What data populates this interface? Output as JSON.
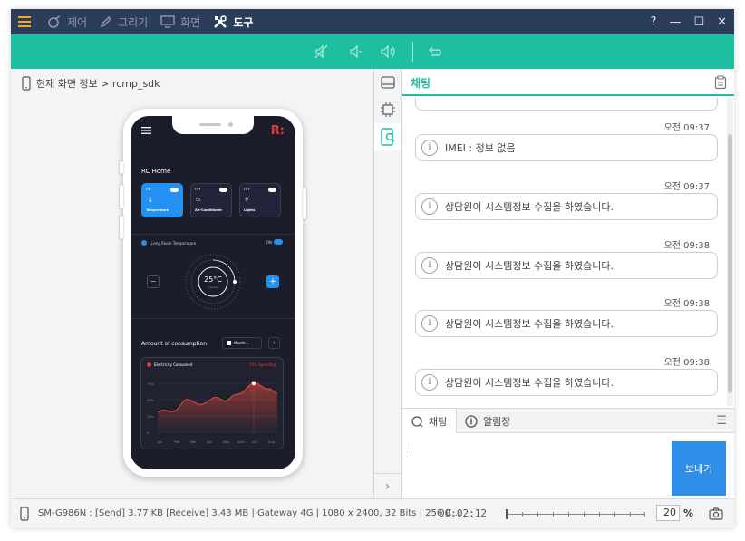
{
  "titlebar": {
    "menus": [
      {
        "label": "제어",
        "icon": "control-icon"
      },
      {
        "label": "그리기",
        "icon": "pen-icon"
      },
      {
        "label": "화면",
        "icon": "monitor-icon"
      },
      {
        "label": "도구",
        "icon": "tools-icon"
      }
    ],
    "active_menu": "도구",
    "help": "?",
    "minimize": "—",
    "maximize": "☐",
    "close": "✕"
  },
  "breadcrumb": {
    "text": "현재 화면 정보 > rcmp_sdk"
  },
  "phone_app": {
    "title": "RC Home",
    "logo": "R:",
    "cards": [
      {
        "state": "ON",
        "label": "Temperature"
      },
      {
        "state": "OFF",
        "label": "Air-Conditioner"
      },
      {
        "state": "OFF",
        "label": "Lights"
      }
    ],
    "room_label": "Living Room Temperature",
    "room_toggle": "ON",
    "temperature": "25°C",
    "temperature_sub": "Celsius",
    "minus": "−",
    "plus": "+",
    "consumption_title": "Amount of consumption",
    "period": "Month",
    "electricity_label": "Electricity Consumed",
    "spending_label": "75% Spending",
    "y_ticks": [
      "75%",
      "50%",
      "25%",
      "0"
    ],
    "months": [
      "Jan",
      "Feb",
      "Mar",
      "Apr",
      "May",
      "June",
      "July",
      "Aug"
    ]
  },
  "chat": {
    "title": "채팅",
    "messages": [
      {
        "time": "오전 09:37",
        "text": "IMEI : 정보 없음"
      },
      {
        "time": "오전 09:37",
        "text": "상담원이 시스템정보 수집을 하였습니다."
      },
      {
        "time": "오전 09:38",
        "text": "상담원이 시스템정보 수집을 하였습니다."
      },
      {
        "time": "오전 09:38",
        "text": "상담원이 시스템정보 수집을 하였습니다."
      },
      {
        "time": "오전 09:38",
        "text": "상담원이 시스템정보 수집을 하였습니다."
      }
    ],
    "tabs": [
      {
        "label": "채팅",
        "icon": "chat-icon",
        "active": true
      },
      {
        "label": "알림장",
        "icon": "info-icon",
        "active": false
      }
    ],
    "input_value": "",
    "send_label": "보내기"
  },
  "statusbar": {
    "info": "SM-G986N : [Send] 3.77 KB  [Receive] 3.43 MB | Gateway 4G | 1080 x 2400, 32 Bits | 256 C...",
    "timer": "00:02:12",
    "zoom_value": "20",
    "zoom_unit": "%"
  },
  "colors": {
    "titlebar": "#2b3d58",
    "accent": "#1dbfa0",
    "send_button": "#2f8ee8",
    "phone_screen": "#1b1d2a"
  }
}
